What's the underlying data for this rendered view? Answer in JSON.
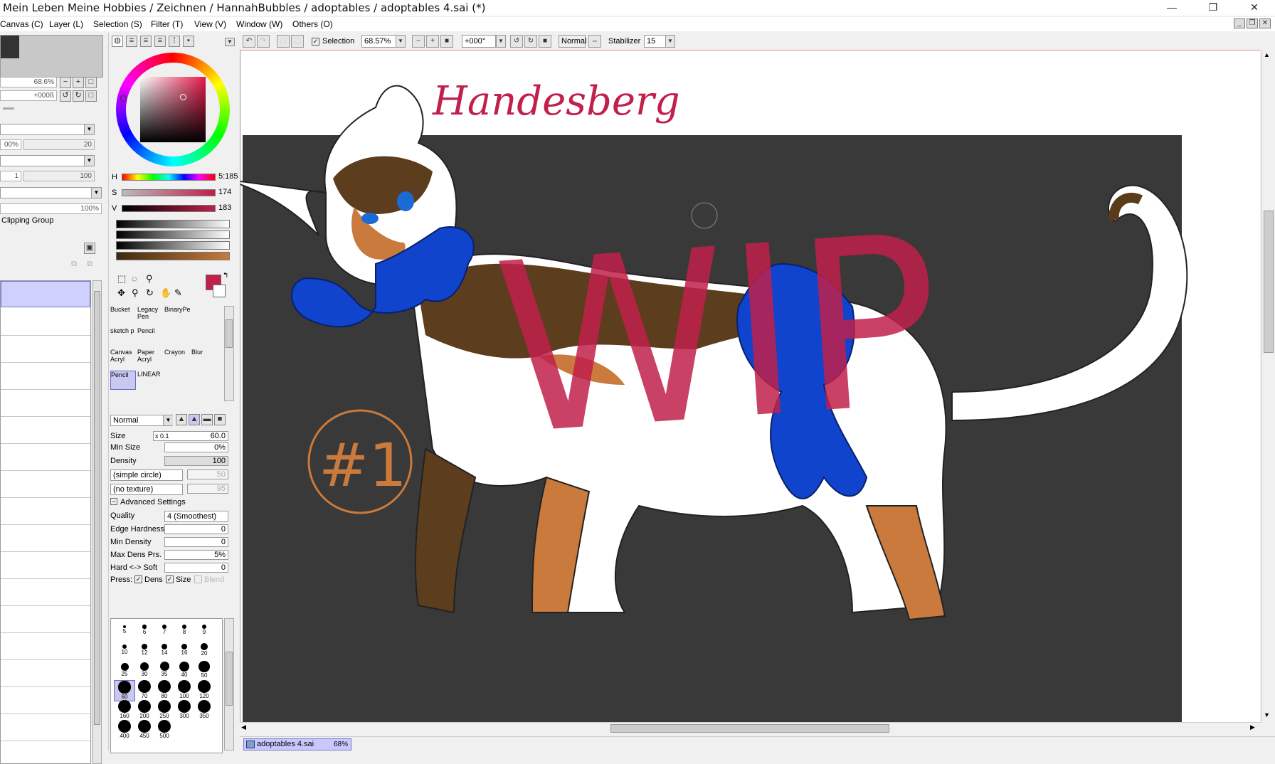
{
  "window": {
    "title": "Mein Leben Meine Hobbies / Zeichnen / HannahBubbles / adoptables / adoptables 4.sai (*)",
    "minimize": "—",
    "maximize": "❐",
    "close": "✕"
  },
  "menu": [
    "Canvas (C)",
    "Layer (L)",
    "Selection (S)",
    "Filter (T)",
    "View (V)",
    "Window (W)",
    "Others (O)"
  ],
  "navigator": {
    "zoom": "68.6%",
    "rotation": "+000ß"
  },
  "layer_panel": {
    "opacity_pct": "100%",
    "opacity_max": "100%",
    "clipping_label": "Clipping Group",
    "slider_vals": [
      "00%",
      "20",
      "1",
      "100"
    ]
  },
  "color": {
    "current": "#c0204a",
    "hsv": {
      "h_label": "H",
      "h_val": "5:185",
      "s_label": "S",
      "s_val": "174",
      "v_label": "V",
      "v_val": "183"
    }
  },
  "tools": [
    {
      "label": "Bucket",
      "selected": false
    },
    {
      "label": "Legacy Pen",
      "selected": false
    },
    {
      "label": "BinaryPe",
      "selected": false
    },
    {
      "label": "sketch p",
      "selected": false
    },
    {
      "label": "Pencil",
      "selected": false
    },
    {
      "label": "",
      "selected": false
    },
    {
      "label": "Canvas Acryl",
      "selected": false
    },
    {
      "label": "Paper Acryl",
      "selected": false
    },
    {
      "label": "Crayon",
      "selected": false
    },
    {
      "label": "Blur",
      "selected": false
    },
    {
      "label": "Pencil",
      "selected": true
    },
    {
      "label": "LINEAR",
      "selected": false
    }
  ],
  "tool_settings": {
    "blend_mode": "Normal",
    "size_label": "Size",
    "size_mult": "x 0.1",
    "size_val": "60.0",
    "min_size_label": "Min Size",
    "min_size_val": "0%",
    "density_label": "Density",
    "density_val": "100",
    "shape": "(simple circle)",
    "shape_val": "50",
    "texture": "(no texture)",
    "texture_val": "95",
    "advanced_label": "Advanced Settings",
    "quality_label": "Quality",
    "quality_val": "4 (Smoothest)",
    "edge_label": "Edge Hardness",
    "edge_val": "0",
    "min_density_label": "Min Density",
    "min_density_val": "0",
    "max_dens_label": "Max Dens Prs.",
    "max_dens_val": "5%",
    "hard_soft_label": "Hard <-> Soft",
    "hard_soft_val": "0",
    "press_label": "Press:",
    "press_dens": "Dens",
    "press_size": "Size",
    "press_blend": "Blend"
  },
  "brush_sizes": [
    "5",
    "6",
    "7",
    "8",
    "9",
    "10",
    "12",
    "14",
    "16",
    "20",
    "25",
    "30",
    "35",
    "40",
    "50",
    "60",
    "70",
    "80",
    "100",
    "120",
    "160",
    "200",
    "250",
    "300",
    "350",
    "400",
    "450",
    "500"
  ],
  "toolbar": {
    "selection_label": "Selection",
    "zoom": "68.57%",
    "rotation": "+000°",
    "blend": "Normal",
    "stabilizer_label": "Stabilizer",
    "stabilizer_val": "15"
  },
  "canvas_text": {
    "signature": "Handesberg",
    "wip": "WIP",
    "badge": "#1"
  },
  "document_tab": {
    "name": "adoptables 4.sai",
    "zoom": "68%"
  }
}
